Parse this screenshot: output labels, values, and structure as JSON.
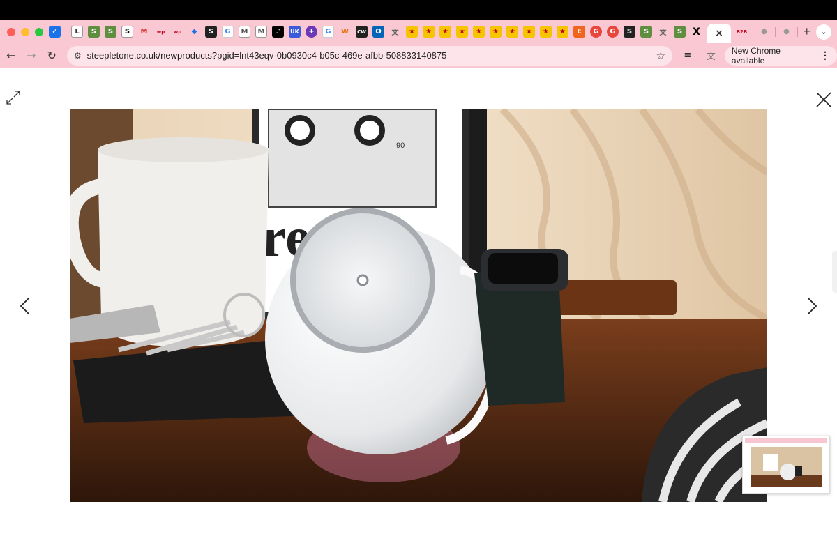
{
  "browser": {
    "tabs": [
      "L",
      "S",
      "S",
      "S",
      "M",
      "wp",
      "wp",
      "G",
      "M",
      "M",
      "UK",
      "G",
      "W",
      "CW",
      "E",
      "B2B"
    ],
    "active_tab_close": "×",
    "new_tab": "+",
    "tab_search": "⌄",
    "nav": {
      "back": "←",
      "forward": "→",
      "reload": "↻"
    },
    "url": "steepletone.co.uk/newproducts?pgid=lnt43eqv-0b0930c4-b05c-469e-afbb-508833140875",
    "bookmark_star": "☆",
    "update_label": "New Chrome available",
    "menu": "⋮"
  },
  "lightbox": {
    "photo_number_on_cassette": "90",
    "colors": {
      "accent_pink": "#f9c8d2",
      "background": "#ffffff"
    },
    "icons": [
      "expand-icon",
      "close-icon",
      "chevron-left-icon",
      "chevron-right-icon"
    ]
  }
}
